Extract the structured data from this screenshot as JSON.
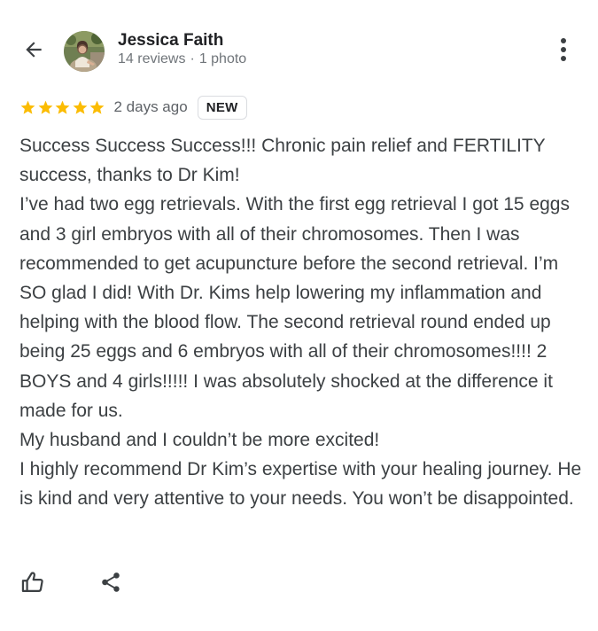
{
  "author": {
    "name": "Jessica Faith",
    "reviews": "14 reviews",
    "separator": "·",
    "photos": "1 photo",
    "avatar_icon": "profile-photo"
  },
  "rating": {
    "stars": 5,
    "max_stars": 5,
    "star_color": "#fbbc04",
    "date": "2 days ago",
    "badge": "NEW"
  },
  "review_text": "Success Success Success!!! Chronic pain relief and FERTILITY success, thanks to Dr Kim!\nI’ve had two egg retrievals. With the first egg retrieval I got 15 eggs and 3 girl embryos with all of their chromosomes. Then I was recommended to get acupuncture before the second retrieval. I’m SO glad I did! With Dr. Kims help lowering my inflammation and helping with the blood flow. The second retrieval round ended up being 25 eggs and 6 embryos with all of their chromosomes!!!! 2 BOYS and 4 girls!!!!! I was absolutely shocked at the difference it made for us.\nMy husband and I couldn’t be more excited!\nI highly recommend Dr Kim’s expertise with your healing journey. He is kind and very attentive to your needs. You won’t be disappointed.",
  "icons": {
    "back": "arrow-back-icon",
    "more": "more-vert-icon",
    "like": "thumb-up-icon",
    "share": "share-icon"
  }
}
